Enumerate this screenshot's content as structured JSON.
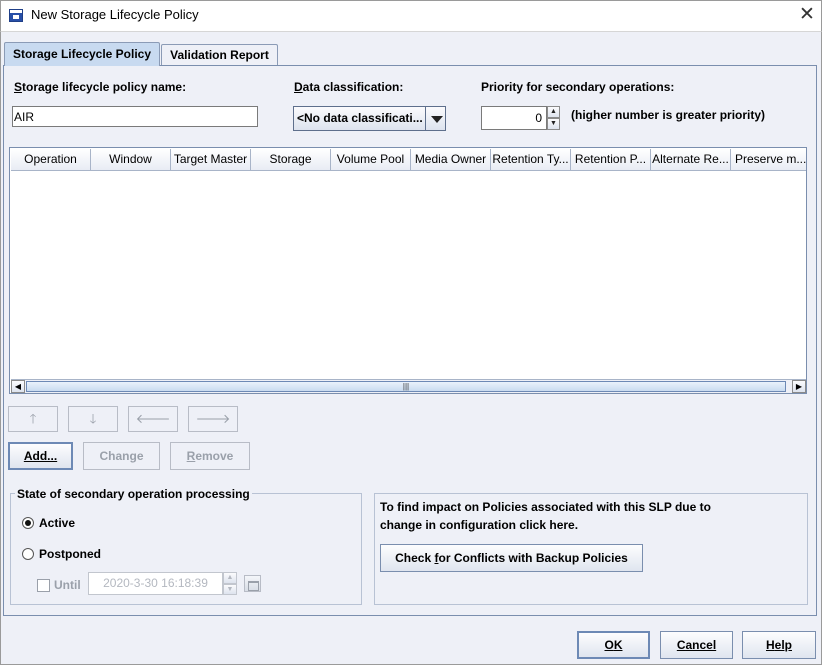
{
  "window": {
    "title": "New Storage Lifecycle Policy"
  },
  "tabs": [
    {
      "label": "Storage Lifecycle Policy",
      "active": true
    },
    {
      "label": "Validation Report",
      "active": false
    }
  ],
  "form": {
    "policy_name_label_first": "S",
    "policy_name_label_rest": "torage lifecycle policy name:",
    "policy_name_value": "AIR",
    "data_class_label_first": "D",
    "data_class_label_rest": "ata classification:",
    "data_class_value": "<No data classificati...",
    "priority_label": "Priority for secondary operations:",
    "priority_value": "0",
    "priority_hint": "(higher number is greater priority)"
  },
  "table": {
    "columns": [
      "Operation",
      "Window",
      "Target Master",
      "Storage",
      "Volume Pool",
      "Media Owner",
      "Retention Ty...",
      "Retention P...",
      "Alternate Re...",
      "Preserve m..."
    ],
    "rows": []
  },
  "move_buttons": {
    "up": "🡑",
    "down": "🡓",
    "left": "🡐",
    "right": "🡒"
  },
  "actions": {
    "add_first": "A",
    "add_rest": "dd...",
    "change": "Change",
    "remove_first": "R",
    "remove_rest": "emove"
  },
  "state_group": {
    "title": "State of secondary operation processing",
    "active": "Active",
    "postponed": "Postponed",
    "until": "Until",
    "date_value": "2020-3-30 16:18:39",
    "selected": "Active"
  },
  "conflicts": {
    "description_line1": "To find impact on Policies associated with this SLP due to",
    "description_line2": "change in configuration click here.",
    "button_before": "Check ",
    "button_key": "f",
    "button_after": "or Conflicts with Backup Policies"
  },
  "footer": {
    "ok_first": "O",
    "ok_rest": "K",
    "cancel_first": "C",
    "cancel_rest": "ancel",
    "help_first": "H",
    "help_rest": "elp"
  },
  "colors": {
    "panel_bg": "#eef0f7",
    "tab_active": "#c8daf0",
    "border": "#7a8eae"
  }
}
